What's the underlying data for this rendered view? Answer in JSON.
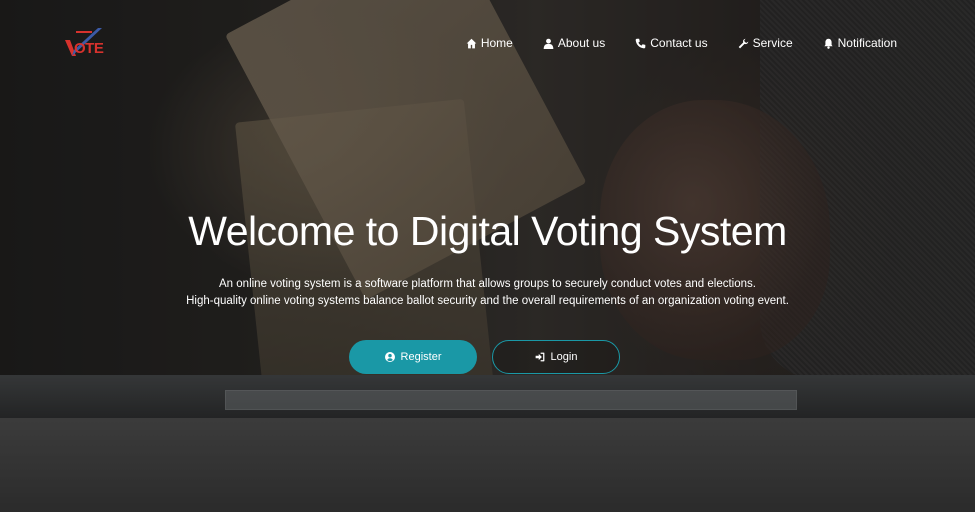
{
  "brand": {
    "logo_text": "OTE",
    "logo_colors": [
      "#d7322d",
      "#3c5aa6"
    ]
  },
  "nav": {
    "items": [
      {
        "label": "Home",
        "icon": "home-icon"
      },
      {
        "label": "About us",
        "icon": "user-icon"
      },
      {
        "label": "Contact us",
        "icon": "phone-icon"
      },
      {
        "label": "Service",
        "icon": "wrench-icon"
      },
      {
        "label": "Notification",
        "icon": "bell-icon"
      }
    ]
  },
  "hero": {
    "title": "Welcome to Digital Voting System",
    "description_line1": "An online voting system is a software platform that allows groups to securely conduct votes and elections.",
    "description_line2": "High-quality online voting systems balance ballot security and the overall requirements of an organization voting event.",
    "register_label": "Register",
    "login_label": "Login",
    "accent_color": "#1a98a6"
  }
}
